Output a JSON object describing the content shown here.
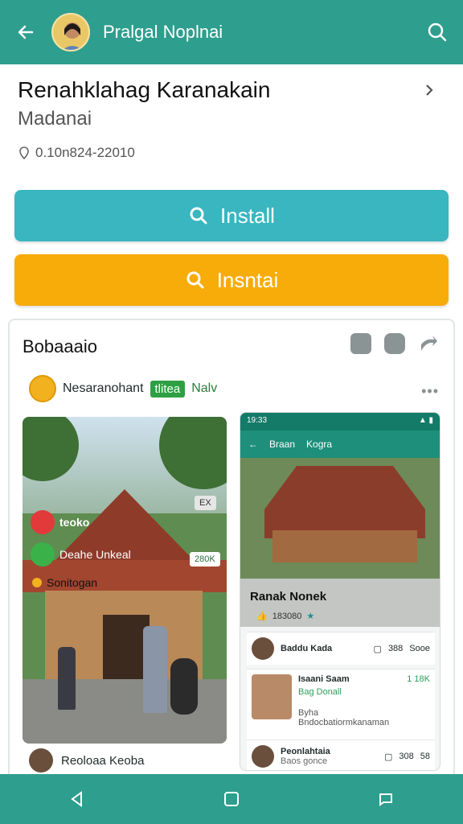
{
  "topbar": {
    "title": "Pralgal Noplnai",
    "back_icon": "arrow-left-icon",
    "search_icon": "search-icon",
    "color": "#2e9e8e"
  },
  "app": {
    "name": "Renahklahag Karanakain",
    "developer": "Madanai",
    "meta": "0.10n824-22010"
  },
  "buttons": {
    "install_label": "Install",
    "install_color": "#39b6c0",
    "secondary_label": "Insntai",
    "secondary_color": "#f8ac0a"
  },
  "gallery": {
    "title": "Bobaaaio",
    "source_name": "Nesaranohant",
    "tag": "tlitea",
    "tag_new": "Nalv",
    "left_shot": {
      "chip1": "teoko",
      "chip2": "Deahe Unkeal",
      "chip3": "Sonitogan",
      "badge": "280K",
      "corner": "EX"
    },
    "right_shot": {
      "status_time": "19:33",
      "tab1": "Braan",
      "tab2": "Kogra",
      "place_name": "Ranak Nonek",
      "likes": "183080",
      "posts": [
        {
          "name": "Baddu Kada",
          "count": "388",
          "extra": "Sooe"
        },
        {
          "name": "Isaani Saam",
          "sub": "Bag Donall",
          "body": "Byha Bndocbatiormkanaman",
          "count": "1 18K"
        },
        {
          "name": "Peonlahtaia",
          "sub": "Baos gonce",
          "count": "308",
          "extra": "58"
        }
      ]
    },
    "footer_user": "Reoloaa Keoba"
  },
  "navbar": {
    "back": "nav-back-icon",
    "home": "nav-home-icon",
    "recents": "nav-recents-icon"
  }
}
